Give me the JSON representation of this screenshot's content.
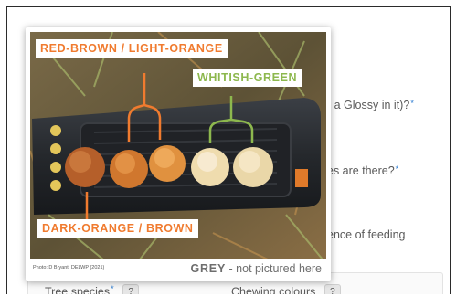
{
  "form": {
    "question_1_tail": "r a Glossy in it)?",
    "question_2_tail": "es are there?",
    "question_3_tail": "ence of feeding",
    "required_marker": "*",
    "tree_species_label": "Tree species",
    "chewing_colours_label": "Chewing colours",
    "help_label": "?"
  },
  "popup": {
    "label_red_brown": "RED-BROWN / LIGHT-ORANGE",
    "label_whitish_green": "WHITISH-GREEN",
    "label_dark_orange": "DARK-ORANGE / BROWN",
    "photo_credit": "Photo: D Bryant, DELWP (2021)",
    "grey_label": "GREY",
    "grey_note": " - not pictured here"
  },
  "colors": {
    "orange_accent": "#f07b2f",
    "green_accent": "#8db84e",
    "required_blue": "#2b7bd1"
  }
}
